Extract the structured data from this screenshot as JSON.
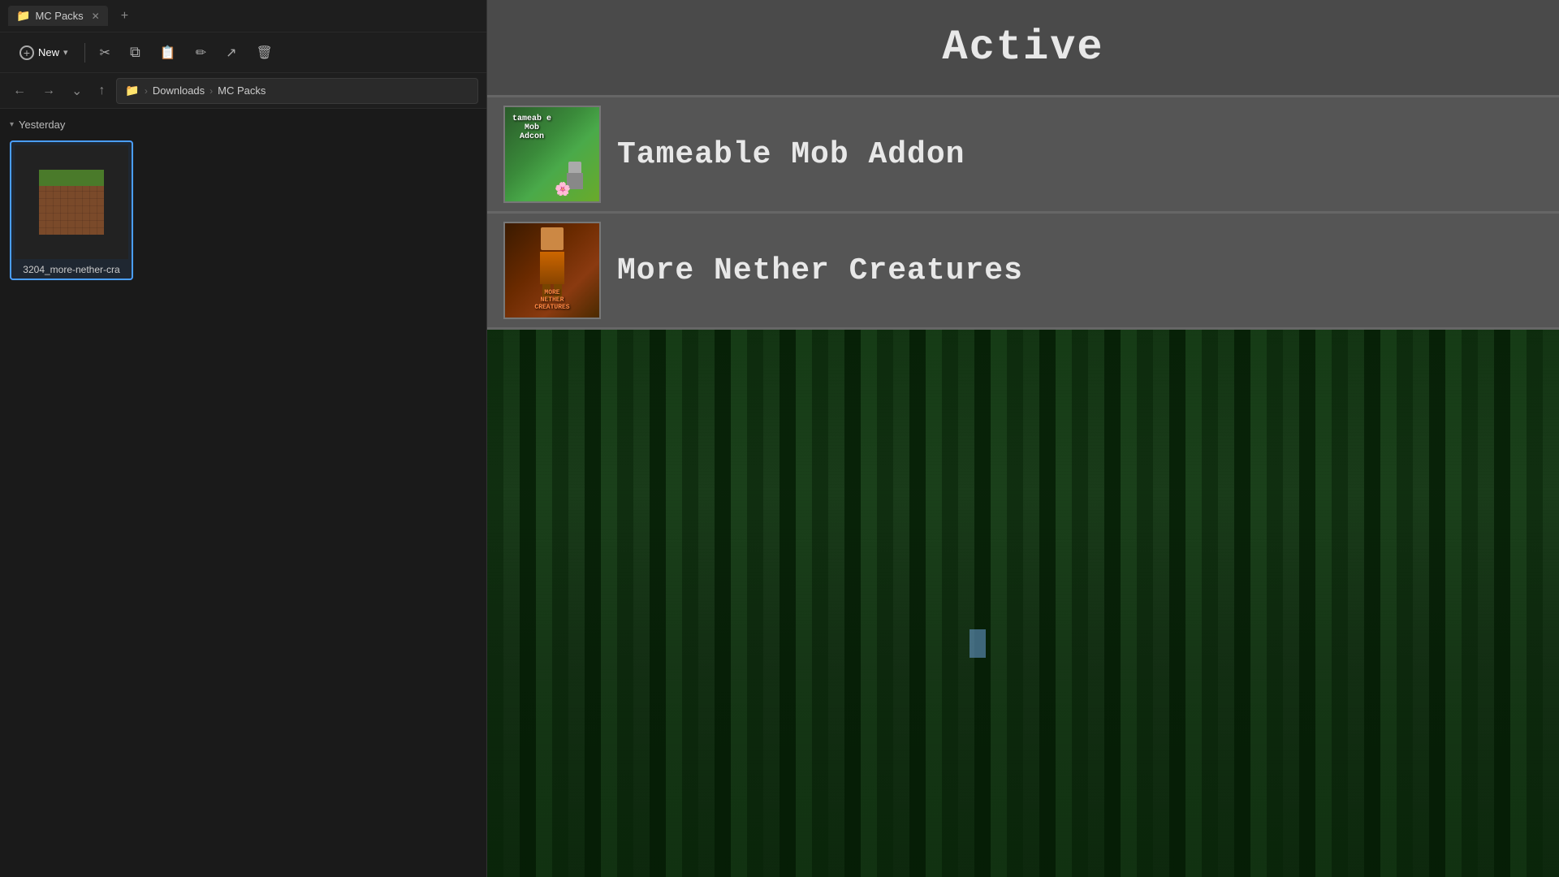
{
  "explorer": {
    "tab": {
      "title": "MC Packs",
      "folder_icon": "📁",
      "close": "✕",
      "add": "+"
    },
    "toolbar": {
      "new_label": "New",
      "new_icon": "+",
      "chevron": "⌄",
      "cut_icon": "✂",
      "copy_icon": "⧉",
      "paste_icon": "📋",
      "rename_icon": "✏",
      "share_icon": "↗",
      "delete_icon": "🗑"
    },
    "nav": {
      "back": "←",
      "forward": "→",
      "dropdown": "⌄",
      "up": "↑"
    },
    "breadcrumb": {
      "folder_icon": "📁",
      "sep1": "›",
      "part1": "Downloads",
      "sep2": "›",
      "part2": "MC Packs"
    },
    "section": {
      "label": "Yesterday",
      "chevron": "⌄"
    },
    "file": {
      "name": "3204_more-nether-cra"
    }
  },
  "minecraft": {
    "active_label": "Active",
    "addons": [
      {
        "id": "tameable",
        "name": "Tameable Mob Addon",
        "thumb_label": "Tameable\nMob\nAddon"
      },
      {
        "id": "nether",
        "name": "More Nether Creatures",
        "thumb_label": "MORE\nNETHER\nCREATURES"
      }
    ]
  }
}
